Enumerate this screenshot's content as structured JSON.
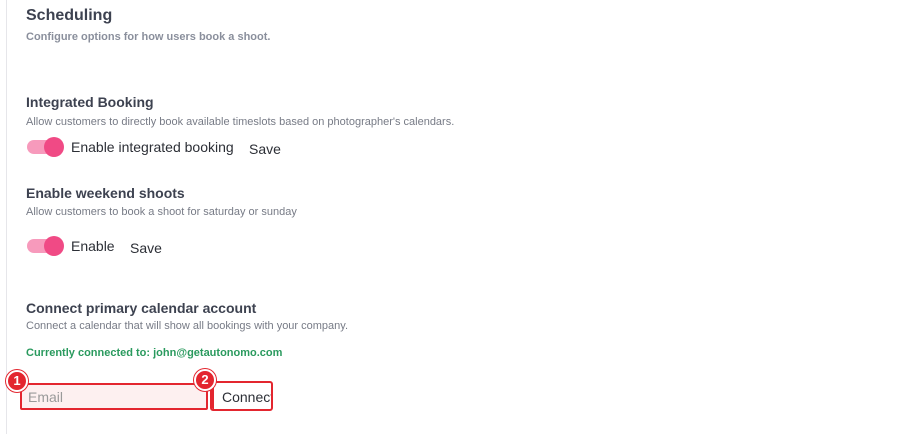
{
  "header": {
    "title": "Scheduling",
    "subtitle": "Configure options for how users book a shoot."
  },
  "integrated_booking": {
    "title": "Integrated Booking",
    "description": "Allow customers to directly book available timeslots based on photographer's calendars.",
    "toggle_label": "Enable integrated booking",
    "toggle_on": true,
    "save_label": "Save"
  },
  "weekend_shoots": {
    "title": "Enable weekend shoots",
    "description": "Allow customers to book a shoot for saturday or sunday",
    "toggle_label": "Enable",
    "toggle_on": true,
    "save_label": "Save"
  },
  "calendar": {
    "title": "Connect primary calendar account",
    "description": "Connect a calendar that will show all bookings with your company.",
    "connected_text": "Currently connected to: john@getautonomo.com",
    "email_placeholder": "Email",
    "email_value": "",
    "connect_label": "Connect"
  },
  "markers": [
    "1",
    "2"
  ],
  "colors": {
    "toggle_track": "#f79abc",
    "toggle_knob": "#f04a85",
    "connected_text": "#2a9a5e",
    "annotation_red": "#e3262f"
  }
}
